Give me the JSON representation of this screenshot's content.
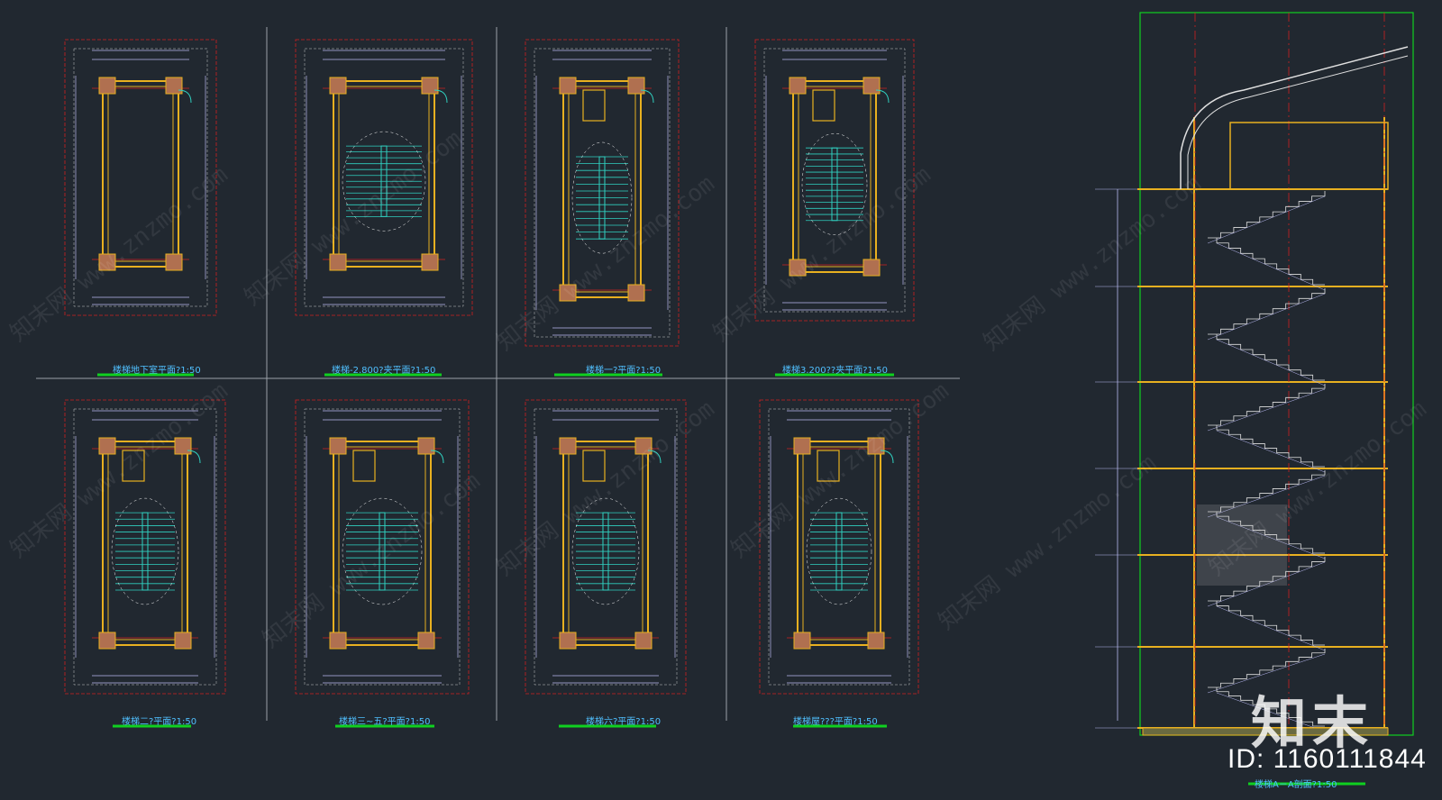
{
  "colors": {
    "background": "#212830",
    "wall_outline": "#e8b020",
    "column_fill": "#b07050",
    "stair": "#30d0c0",
    "dim_lines": "#b8b8f0",
    "grid_red": "#d02020",
    "title_underline": "#10d020",
    "title_text": "#50c0ff",
    "frame_green": "#10d020"
  },
  "drawing_titles": [
    {
      "text": "楼梯地下室平面?1:50"
    },
    {
      "text": "楼梯-2.800?夹平面?1:50"
    },
    {
      "text": "楼梯一?平面?1:50"
    },
    {
      "text": "楼梯3.200??夹平面?1:50"
    },
    {
      "text": "楼梯二?平面?1:50"
    },
    {
      "text": "楼梯三~五?平面?1:50"
    },
    {
      "text": "楼梯六?平面?1:50"
    },
    {
      "text": "楼梯屋???平面?1:50"
    }
  ],
  "section_title": "楼梯A－A剖面?1:50",
  "watermark": {
    "logo": "知末",
    "id_text": "ID: 1160111844",
    "site": "www.znzmo.com",
    "brand": "知末网"
  },
  "icons": [
    "stair-plan-icon",
    "section-elevation-icon"
  ]
}
